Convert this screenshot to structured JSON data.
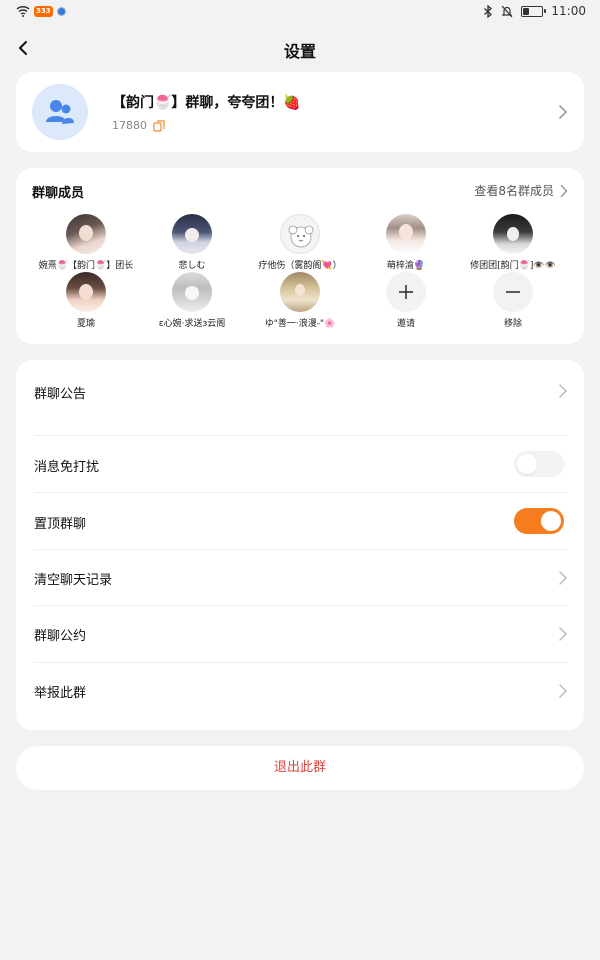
{
  "status_bar": {
    "app_badge": "333",
    "time": "11:00",
    "battery_level": 0.3
  },
  "header": {
    "title": "设置"
  },
  "group": {
    "name": "【韵门🍧】群聊，夸夸团！🍓",
    "id": "17880"
  },
  "members": {
    "title": "群聊成员",
    "view_all": "查看8名群成员",
    "list": [
      {
        "name": "婉熹🍧【韵门🍧】团长"
      },
      {
        "name": "悲しむ"
      },
      {
        "name": "疗他伤（雾韵阁💘）"
      },
      {
        "name": "萌梓渝🔮"
      },
      {
        "name": "修团团[韵门🍧]👁️👁️"
      },
      {
        "name": "夏瑜"
      },
      {
        "name": "ɛ心婉·求送з云阁"
      },
      {
        "name": "ゆ\"善一·浪漫-\"🌸"
      }
    ],
    "invite_label": "邀请",
    "remove_label": "移除"
  },
  "settings": {
    "announcement": "群聊公告",
    "do_not_disturb": "消息免打扰",
    "do_not_disturb_on": false,
    "pin_chat": "置顶群聊",
    "pin_chat_on": true,
    "clear_history": "清空聊天记录",
    "rules": "群聊公约",
    "report": "举报此群"
  },
  "exit_label": "退出此群",
  "colors": {
    "accent": "#f57c1f",
    "danger": "#e0463c",
    "background": "#f2f2f4"
  }
}
